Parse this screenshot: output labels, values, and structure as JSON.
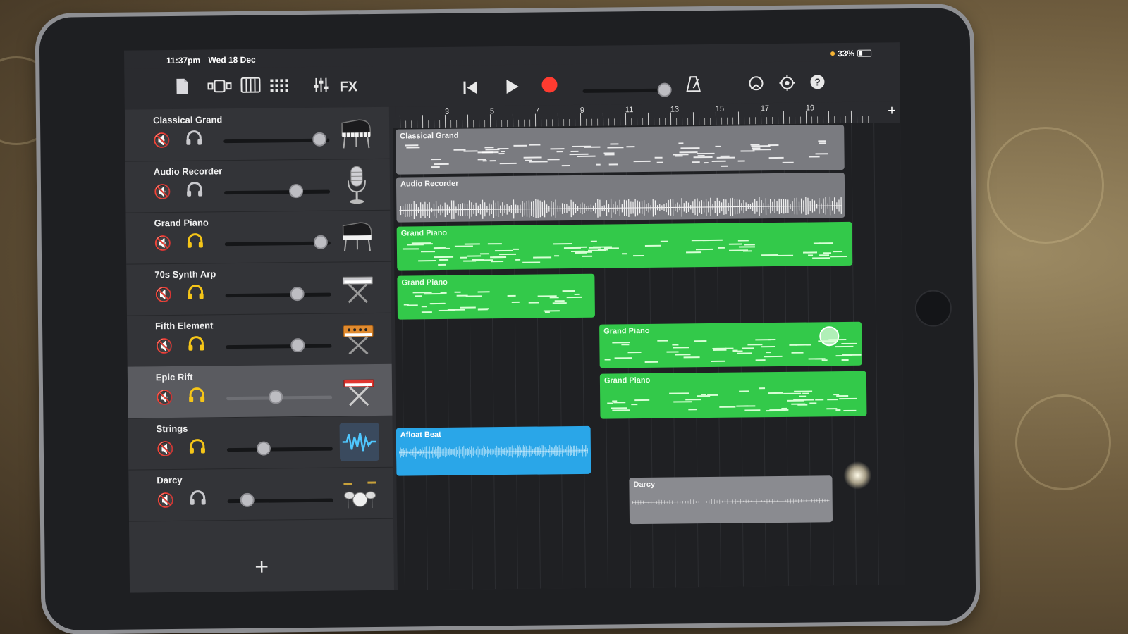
{
  "status": {
    "time": "11:37pm",
    "date": "Wed 18 Dec",
    "battery": "33%"
  },
  "toolbar": {
    "fx_label": "FX"
  },
  "ruler": {
    "numbers": [
      "3",
      "5",
      "7",
      "9",
      "11",
      "13",
      "15",
      "17",
      "19"
    ]
  },
  "tracks": [
    {
      "name": "Classical Grand",
      "instrument": "grand-piano-icon",
      "solo": false,
      "volume": 0.9
    },
    {
      "name": "Audio Recorder",
      "instrument": "microphone-icon",
      "solo": false,
      "volume": 0.68
    },
    {
      "name": "Grand Piano",
      "instrument": "grand-piano-icon",
      "solo": true,
      "volume": 0.9
    },
    {
      "name": "70s Synth Arp",
      "instrument": "keyboard-stand-icon",
      "solo": true,
      "volume": 0.68
    },
    {
      "name": "Fifth Element",
      "instrument": "synth-icon",
      "solo": true,
      "volume": 0.68
    },
    {
      "name": "Epic Rift",
      "instrument": "red-keyboard-icon",
      "solo": true,
      "volume": 0.48,
      "selected": true
    },
    {
      "name": "Strings",
      "instrument": "waveform-icon",
      "solo": true,
      "volume": 0.36
    },
    {
      "name": "Darcy",
      "instrument": "drum-kit-icon",
      "solo": false,
      "volume": 0.22
    }
  ],
  "regions": {
    "classical_grand": "Classical Grand",
    "audio_recorder": "Audio Recorder",
    "grand_piano_1": "Grand Piano",
    "grand_piano_2": "Grand Piano",
    "grand_piano_3": "Grand Piano",
    "grand_piano_4": "Grand Piano",
    "afloat_beat": "Afloat Beat",
    "darcy": "Darcy"
  },
  "colors": {
    "green_region": "#33c94a",
    "blue_region": "#2aa6e8",
    "gray_region": "#7a7b80",
    "record": "#ff3b30",
    "solo_active": "#f5c518"
  }
}
